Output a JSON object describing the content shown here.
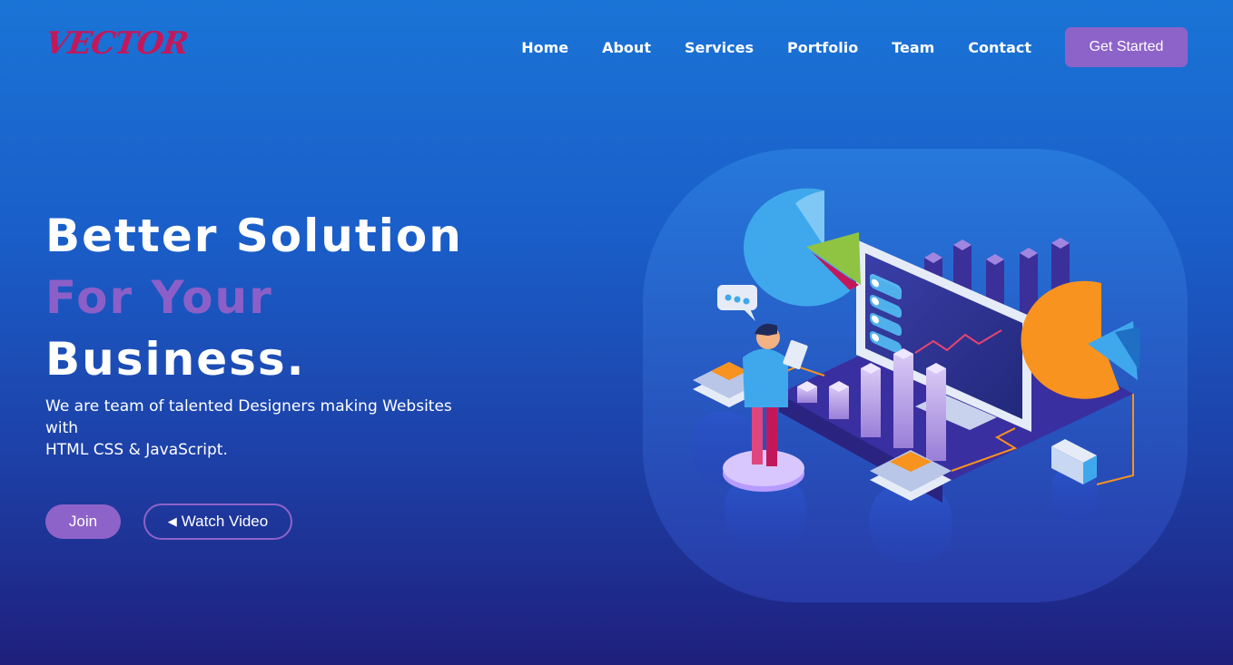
{
  "brand": {
    "logo_text": "VECTOR"
  },
  "nav": {
    "items": [
      {
        "label": "Home"
      },
      {
        "label": "About"
      },
      {
        "label": "Services"
      },
      {
        "label": "Portfolio"
      },
      {
        "label": "Team"
      },
      {
        "label": "Contact"
      }
    ],
    "cta_label": "Get Started"
  },
  "hero": {
    "line1": "Better Solution",
    "line2": "For Your",
    "line3": "Business.",
    "description_line1": "We are team of talented Designers making Websites",
    "description_line2": "with",
    "description_line3": "HTML CSS & JavaScript.",
    "join_label": "Join",
    "video_label": "Watch Video"
  },
  "colors": {
    "accent": "#8e63c9",
    "logo": "#c2185b",
    "background_top": "#1a74d6",
    "background_bottom": "#1f1f7c"
  },
  "illustration": {
    "icon": "business-analytics-illustration"
  }
}
